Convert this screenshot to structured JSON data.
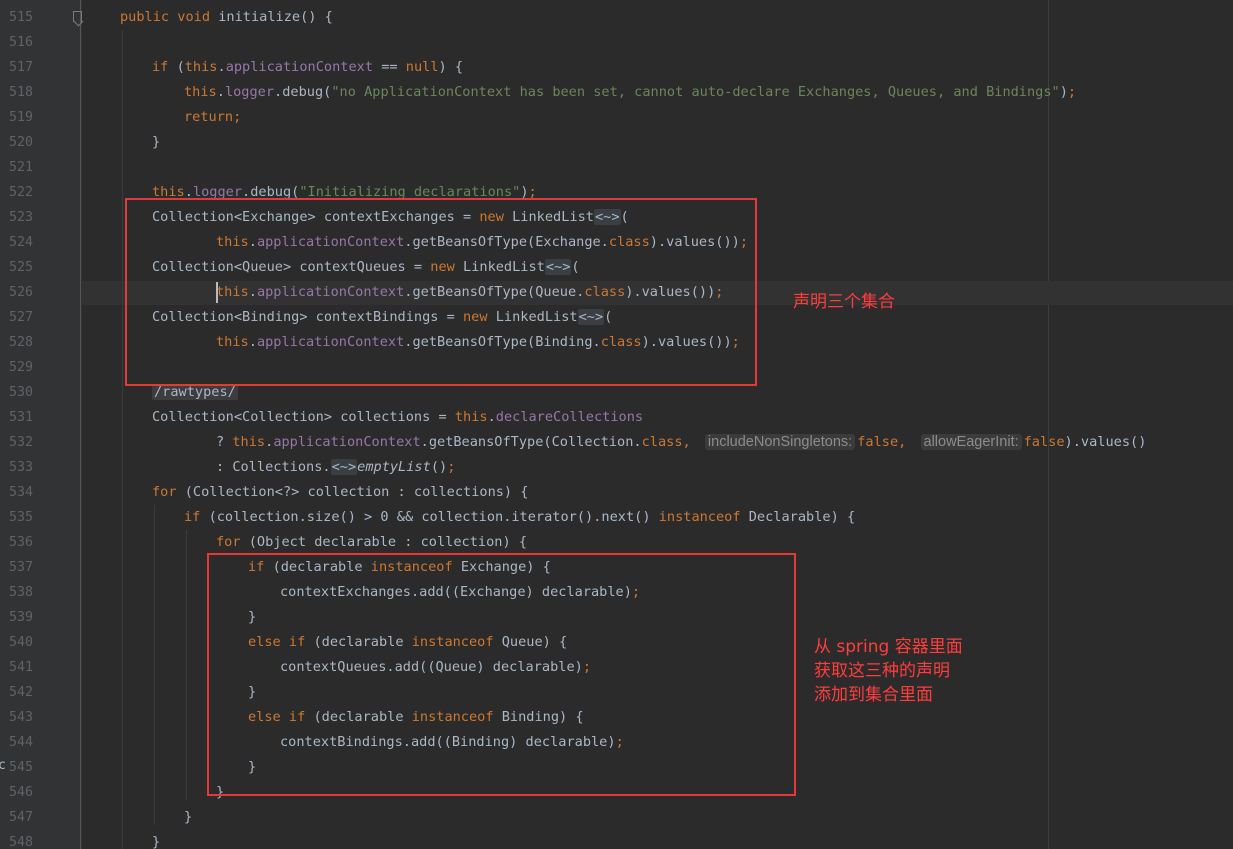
{
  "editor": {
    "lines": [
      {
        "n": "515",
        "indent": 0,
        "tokens": [
          {
            "t": "public void ",
            "c": "kw"
          },
          {
            "t": "initialize",
            "c": "fn"
          },
          {
            "t": "() {"
          }
        ]
      },
      {
        "n": "516",
        "indent": 0,
        "tokens": []
      },
      {
        "n": "517",
        "indent": 1,
        "tokens": [
          {
            "t": "if ",
            "c": "kw"
          },
          {
            "t": "("
          },
          {
            "t": "this",
            "c": "kw"
          },
          {
            "t": "."
          },
          {
            "t": "applicationContext",
            "c": "fld"
          },
          {
            "t": " == "
          },
          {
            "t": "null",
            "c": "kw"
          },
          {
            "t": ") {"
          }
        ]
      },
      {
        "n": "518",
        "indent": 2,
        "tokens": [
          {
            "t": "this",
            "c": "kw"
          },
          {
            "t": "."
          },
          {
            "t": "logger",
            "c": "fld"
          },
          {
            "t": ".debug("
          },
          {
            "t": "\"no ApplicationContext has been set, cannot auto-declare Exchanges, Queues, and Bindings\"",
            "c": "str"
          },
          {
            "t": ")"
          },
          {
            "t": ";",
            "c": "kw"
          }
        ]
      },
      {
        "n": "519",
        "indent": 2,
        "tokens": [
          {
            "t": "return",
            "c": "kw"
          },
          {
            "t": ";",
            "c": "kw"
          }
        ]
      },
      {
        "n": "520",
        "indent": 1,
        "tokens": [
          {
            "t": "}"
          }
        ]
      },
      {
        "n": "521",
        "indent": 0,
        "tokens": []
      },
      {
        "n": "522",
        "indent": 1,
        "tokens": [
          {
            "t": "this",
            "c": "kw"
          },
          {
            "t": "."
          },
          {
            "t": "logger",
            "c": "fld"
          },
          {
            "t": ".debug("
          },
          {
            "t": "\"Initializing declarations\"",
            "c": "str"
          },
          {
            "t": ")"
          },
          {
            "t": ";",
            "c": "kw"
          }
        ]
      },
      {
        "n": "523",
        "indent": 1,
        "tokens": [
          {
            "t": "Collection<Exchange> contextExchanges = "
          },
          {
            "t": "new ",
            "c": "kw"
          },
          {
            "t": "LinkedList"
          },
          {
            "t": "<~>",
            "c": "fold"
          },
          {
            "t": "("
          }
        ]
      },
      {
        "n": "524",
        "indent": 3,
        "tokens": [
          {
            "t": "this",
            "c": "kw"
          },
          {
            "t": "."
          },
          {
            "t": "applicationContext",
            "c": "fld"
          },
          {
            "t": ".getBeansOfType(Exchange."
          },
          {
            "t": "class",
            "c": "kw"
          },
          {
            "t": ").values())"
          },
          {
            "t": ";",
            "c": "kw"
          }
        ]
      },
      {
        "n": "525",
        "indent": 1,
        "tokens": [
          {
            "t": "Collection<Queue> contextQueues = "
          },
          {
            "t": "new ",
            "c": "kw"
          },
          {
            "t": "LinkedList"
          },
          {
            "t": "<~>",
            "c": "fold"
          },
          {
            "t": "("
          }
        ]
      },
      {
        "n": "526",
        "indent": 3,
        "tokens": [
          {
            "t": "this",
            "c": "kw"
          },
          {
            "t": "."
          },
          {
            "t": "applicationContext",
            "c": "fld"
          },
          {
            "t": ".getBeansOfType(Queue."
          },
          {
            "t": "class",
            "c": "kw"
          },
          {
            "t": ").values())"
          },
          {
            "t": ";",
            "c": "kw"
          }
        ]
      },
      {
        "n": "527",
        "indent": 1,
        "tokens": [
          {
            "t": "Collection<Binding> contextBindings = "
          },
          {
            "t": "new ",
            "c": "kw"
          },
          {
            "t": "LinkedList"
          },
          {
            "t": "<~>",
            "c": "fold"
          },
          {
            "t": "("
          }
        ]
      },
      {
        "n": "528",
        "indent": 3,
        "tokens": [
          {
            "t": "this",
            "c": "kw"
          },
          {
            "t": "."
          },
          {
            "t": "applicationContext",
            "c": "fld"
          },
          {
            "t": ".getBeansOfType(Binding."
          },
          {
            "t": "class",
            "c": "kw"
          },
          {
            "t": ").values())"
          },
          {
            "t": ";",
            "c": "kw"
          }
        ]
      },
      {
        "n": "529",
        "indent": 0,
        "tokens": []
      },
      {
        "n": "530",
        "indent": 1,
        "tokens": [
          {
            "t": "/rawtypes/",
            "c": "comment"
          }
        ]
      },
      {
        "n": "531",
        "indent": 1,
        "tokens": [
          {
            "t": "Collection<Collection> collections = "
          },
          {
            "t": "this",
            "c": "kw"
          },
          {
            "t": "."
          },
          {
            "t": "declareCollections",
            "c": "fld"
          }
        ]
      },
      {
        "n": "532",
        "indent": 3,
        "tokens": [
          {
            "t": "? "
          },
          {
            "t": "this",
            "c": "kw"
          },
          {
            "t": "."
          },
          {
            "t": "applicationContext",
            "c": "fld"
          },
          {
            "t": ".getBeansOfType(Collection."
          },
          {
            "t": "class",
            "c": "kw"
          },
          {
            "t": ", ",
            "c": "kw"
          },
          {
            "t": "includeNonSingletons:",
            "c": "hint"
          },
          {
            "t": "false",
            "c": "kw"
          },
          {
            "t": ", ",
            "c": "kw"
          },
          {
            "t": "allowEagerInit:",
            "c": "hint"
          },
          {
            "t": "false",
            "c": "kw"
          },
          {
            "t": ").values()"
          }
        ]
      },
      {
        "n": "533",
        "indent": 3,
        "tokens": [
          {
            "t": ": Collections."
          },
          {
            "t": "<~>",
            "c": "fold"
          },
          {
            "t": "emptyList",
            "c": "ital"
          },
          {
            "t": "()"
          },
          {
            "t": ";",
            "c": "kw"
          }
        ]
      },
      {
        "n": "534",
        "indent": 1,
        "tokens": [
          {
            "t": "for ",
            "c": "kw"
          },
          {
            "t": "(Collection<?> collection : collections) {"
          }
        ]
      },
      {
        "n": "535",
        "indent": 2,
        "tokens": [
          {
            "t": "if ",
            "c": "kw"
          },
          {
            "t": "(collection.size() > 0 && collection.iterator().next() "
          },
          {
            "t": "instanceof ",
            "c": "kw"
          },
          {
            "t": "Declarable) {"
          }
        ]
      },
      {
        "n": "536",
        "indent": 3,
        "tokens": [
          {
            "t": "for ",
            "c": "kw"
          },
          {
            "t": "(Object declarable : collection) {"
          }
        ]
      },
      {
        "n": "537",
        "indent": 4,
        "tokens": [
          {
            "t": "if ",
            "c": "kw"
          },
          {
            "t": "(declarable "
          },
          {
            "t": "instanceof ",
            "c": "kw"
          },
          {
            "t": "Exchange) {"
          }
        ]
      },
      {
        "n": "538",
        "indent": 5,
        "tokens": [
          {
            "t": "contextExchanges.add((Exchange) declarable)"
          },
          {
            "t": ";",
            "c": "kw"
          }
        ]
      },
      {
        "n": "539",
        "indent": 4,
        "tokens": [
          {
            "t": "}"
          }
        ]
      },
      {
        "n": "540",
        "indent": 4,
        "tokens": [
          {
            "t": "else if ",
            "c": "kw"
          },
          {
            "t": "(declarable "
          },
          {
            "t": "instanceof ",
            "c": "kw"
          },
          {
            "t": "Queue) {"
          }
        ]
      },
      {
        "n": "541",
        "indent": 5,
        "tokens": [
          {
            "t": "contextQueues.add((Queue) declarable)"
          },
          {
            "t": ";",
            "c": "kw"
          }
        ]
      },
      {
        "n": "542",
        "indent": 4,
        "tokens": [
          {
            "t": "}"
          }
        ]
      },
      {
        "n": "543",
        "indent": 4,
        "tokens": [
          {
            "t": "else if ",
            "c": "kw"
          },
          {
            "t": "(declarable "
          },
          {
            "t": "instanceof ",
            "c": "kw"
          },
          {
            "t": "Binding) {"
          }
        ]
      },
      {
        "n": "544",
        "indent": 5,
        "tokens": [
          {
            "t": "contextBindings.add((Binding) declarable)"
          },
          {
            "t": ";",
            "c": "kw"
          }
        ]
      },
      {
        "n": "545",
        "indent": 4,
        "tokens": [
          {
            "t": "}"
          }
        ]
      },
      {
        "n": "546",
        "indent": 3,
        "tokens": [
          {
            "t": "}"
          }
        ]
      },
      {
        "n": "547",
        "indent": 2,
        "tokens": [
          {
            "t": "}"
          }
        ]
      },
      {
        "n": "548",
        "indent": 1,
        "tokens": [
          {
            "t": "}"
          }
        ]
      }
    ]
  },
  "annotations": {
    "declare_note": "声明三个集合",
    "fetch_note": "从 spring 容器里面\n获取这三种的声明\n添加到集合里面"
  },
  "colors": {
    "background": "#2b2b2b",
    "keyword": "#cc7832",
    "field": "#9876aa",
    "string": "#6a8759",
    "text": "#a9b7c6",
    "line_number": "#606366",
    "annotation": "#e53935"
  }
}
